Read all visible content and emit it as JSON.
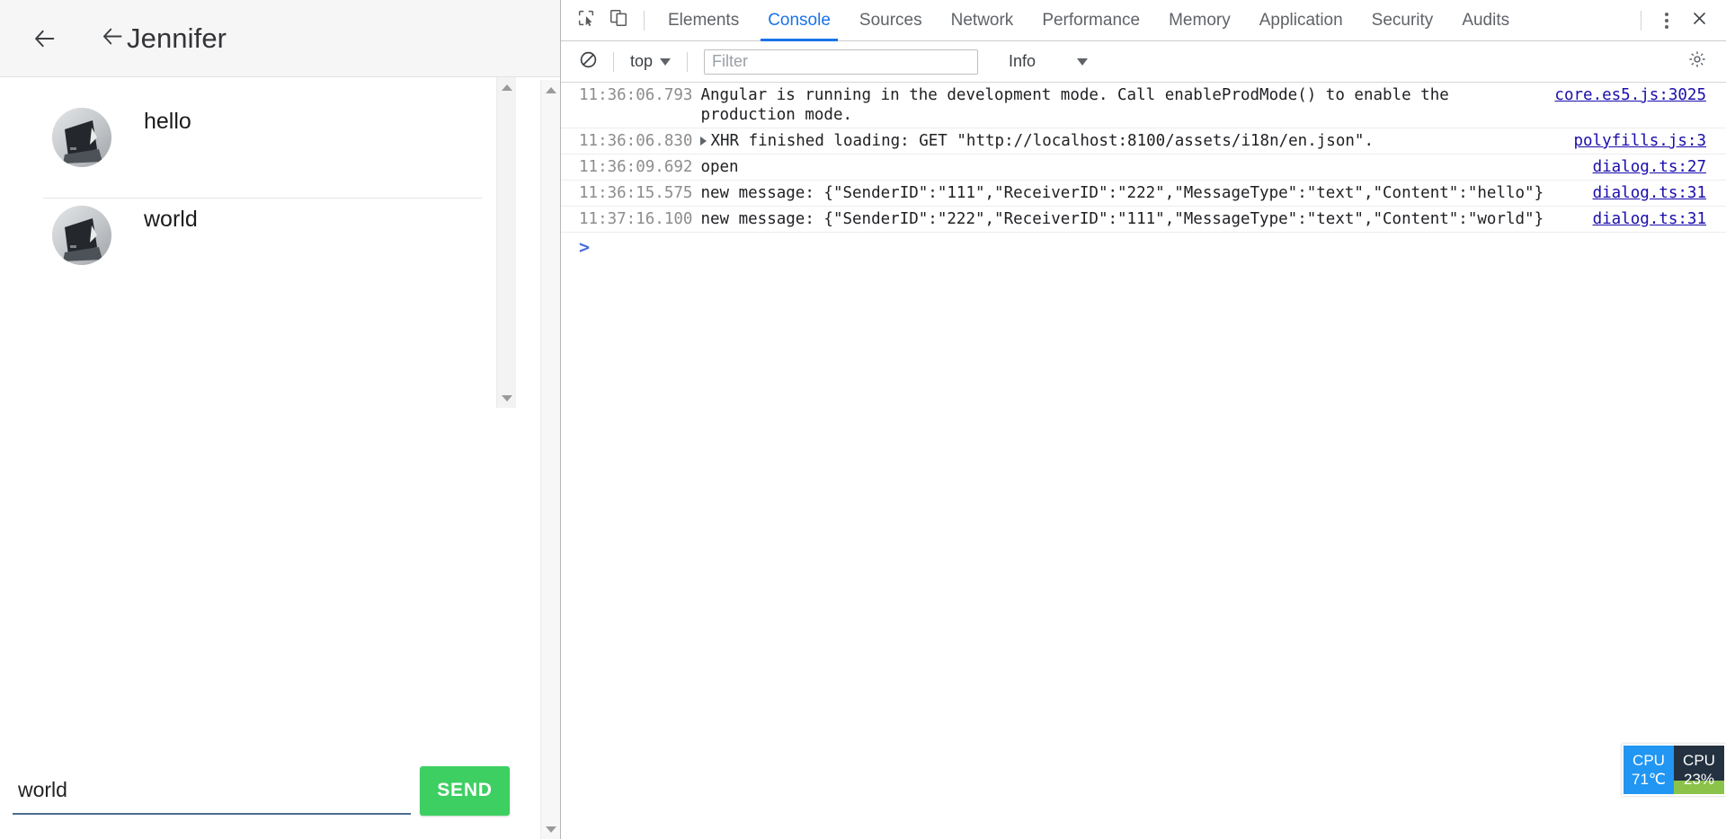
{
  "chat": {
    "nav_back_icon": "arrow-left-icon",
    "title_back_icon": "arrow-left-icon",
    "title": "Jennifer",
    "messages": [
      {
        "avatar_icon": "user-avatar-photo",
        "text": "hello"
      },
      {
        "avatar_icon": "user-avatar-photo",
        "text": "world"
      }
    ],
    "composer": {
      "input_value": "world",
      "input_placeholder": "",
      "send_label": "SEND",
      "send_color": "#3ecf62"
    },
    "scrollbar": {
      "up_icon": "triangle-up-icon",
      "down_icon": "triangle-down-icon"
    }
  },
  "devtools": {
    "toolbar": {
      "inspect_icon": "inspect-element-icon",
      "device_icon": "toggle-device-toolbar-icon",
      "more_icon": "kebab-menu-icon",
      "close_icon": "close-icon"
    },
    "tabs": [
      {
        "label": "Elements",
        "active": false
      },
      {
        "label": "Console",
        "active": true
      },
      {
        "label": "Sources",
        "active": false
      },
      {
        "label": "Network",
        "active": false
      },
      {
        "label": "Performance",
        "active": false
      },
      {
        "label": "Memory",
        "active": false
      },
      {
        "label": "Application",
        "active": false
      },
      {
        "label": "Security",
        "active": false
      },
      {
        "label": "Audits",
        "active": false
      }
    ],
    "active_tab_color": "#1a73e8",
    "filterbar": {
      "clear_icon": "clear-console-icon",
      "context": "top",
      "filter_placeholder": "Filter",
      "filter_value": "",
      "level": "Info",
      "settings_icon": "gear-icon"
    },
    "logs": [
      {
        "time": "11:36:06.793",
        "message": "Angular is running in the development mode. Call enableProdMode() to enable the production mode.",
        "source": "core.es5.js:3025",
        "expandable": false,
        "link": ""
      },
      {
        "time": "11:36:06.830",
        "message_prefix": "XHR finished loading: GET \"",
        "link": "http://localhost:8100/assets/i18n/en.json",
        "message_suffix": "\".",
        "source": "polyfills.js:3",
        "expandable": true
      },
      {
        "time": "11:36:09.692",
        "message": "open",
        "source": "dialog.ts:27",
        "expandable": false,
        "link": ""
      },
      {
        "time": "11:36:15.575",
        "message": "new message: {\"SenderID\":\"111\",\"ReceiverID\":\"222\",\"MessageType\":\"text\",\"Content\":\"hello\"}",
        "source": "dialog.ts:31",
        "expandable": false,
        "link": ""
      },
      {
        "time": "11:37:16.100",
        "message": "new message: {\"SenderID\":\"222\",\"ReceiverID\":\"111\",\"MessageType\":\"text\",\"Content\":\"world\"}",
        "source": "dialog.ts:31",
        "expandable": false,
        "link": ""
      }
    ],
    "prompt": ">"
  },
  "cpu_widget": {
    "temp_label": "CPU",
    "temp_value": "71℃",
    "usage_label": "CPU",
    "usage_value": "23%",
    "temp_color": "#2196f3",
    "usage_color": "#233140",
    "bar_color": "#8bc34a"
  }
}
